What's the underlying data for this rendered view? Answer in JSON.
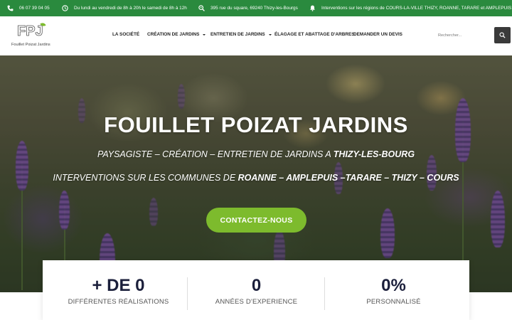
{
  "topbar": {
    "phone": "06 07 39 04 05",
    "hours": "Du lundi au vendredi de 8h à 20h le samedi de 8h à 12h",
    "address": "395 rue du square, 69240 Thizy-les-Bourgs",
    "regions": "Interventions sur les régions de COURS-LA-VILLE THIZY, ROANNE, TARARE et AMPLEPUIS",
    "icons": [
      "phone-icon",
      "clock-icon",
      "search-location-icon",
      "bell-icon"
    ]
  },
  "header": {
    "logo_mark": "FPJ",
    "logo_text": "Fouillet Poizat Jardins",
    "nav": [
      {
        "label": "LA SOCIÉTÉ",
        "has_caret": false
      },
      {
        "label": "CRÉATION DE JARDINS",
        "has_caret": true
      },
      {
        "label": "ENTRETIEN DE JARDINS",
        "has_caret": true
      },
      {
        "label": "ÉLAGAGE ET ABATTAGE D'ARBRES",
        "has_caret": false
      },
      {
        "label": "DEMANDER UN DEVIS",
        "has_caret": false
      }
    ],
    "search": {
      "placeholder": "Rechercher..."
    }
  },
  "hero": {
    "title": "FOUILLET POIZAT JARDINS",
    "sub1_prefix": "PAYSAGISTE – CRÉATION – ENTRETIEN DE JARDINS A ",
    "sub1_bold": "THIZY-LES-BOURG",
    "sub2_prefix": "INTERVENTIONS SUR LES COMMUNES DE ",
    "sub2_bold": "ROANNE – AMPLEPUIS –TARARE – THIZY – COURS",
    "cta": "CONTACTEZ-NOUS"
  },
  "stats": [
    {
      "value": "+ DE 0",
      "label": "DIFFÉRENTES RÉALISATIONS"
    },
    {
      "value": "0",
      "label": "ANNÉES D'EXPERIENCE"
    },
    {
      "value": "0%",
      "label": "PERSONNALISÉ"
    }
  ],
  "colors": {
    "topbar": "#2a8a3e",
    "accent_green": "#7dbb2d",
    "stat_number": "#1b1f3b",
    "search_button": "#3a3a3a"
  }
}
